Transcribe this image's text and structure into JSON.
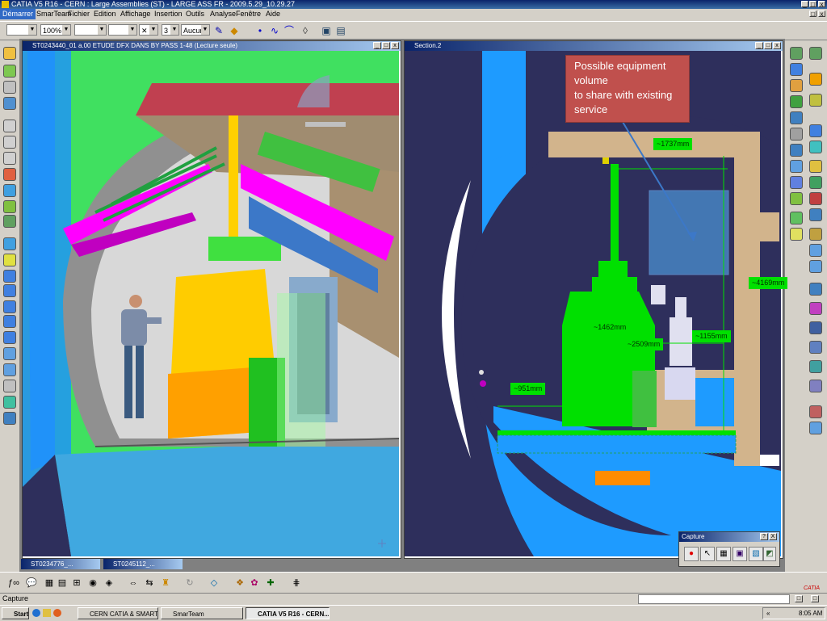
{
  "app": {
    "title": "CATIA V5 R16  -  CERN : Large Assemblies (ST) - LARGE ASS FR - 2009.5.29_10.29.27"
  },
  "menu": [
    "Démarrer",
    "SmarTeam",
    "Fichier",
    "Edition",
    "Affichage",
    "Insertion",
    "Outils",
    "Analyse",
    "Fenêtre",
    "Aide"
  ],
  "toolbar": {
    "zoom_value": "100%",
    "layer_value": "Aucun",
    "number_value": "3"
  },
  "windows": {
    "left_title": "ST0243440_01 a.00 ETUDE DFX DANS BY PASS 1-48 (Lecture seule)",
    "right_title": "Section.2",
    "min_tab_1": "ST0234776_...",
    "min_tab_2": "ST0245112_..."
  },
  "section": {
    "callout": "Possible  equipment\nvolume\nto share with existing\nservice",
    "dims": [
      "~1737mm",
      "~4169mm",
      "~1462mm",
      "~2509mm",
      "~1155mm",
      "~951mm"
    ]
  },
  "capture_toolbar": {
    "title": "Capture",
    "help": "?",
    "close": "X"
  },
  "status": {
    "text": "Capture"
  },
  "taskbar": {
    "start": "Start",
    "tasks": [
      "CERN CATIA & SMARTE...",
      "SmarTeam",
      "CATIA V5 R16  -  CERN..."
    ],
    "clock": "8:05 AM"
  },
  "colors": {
    "navy": "#2e2f5c",
    "green": "#00e000",
    "tan": "#d2b48c",
    "blue": "#1e9bff",
    "callout": "#c0504d",
    "orange": "#ff8c00"
  }
}
